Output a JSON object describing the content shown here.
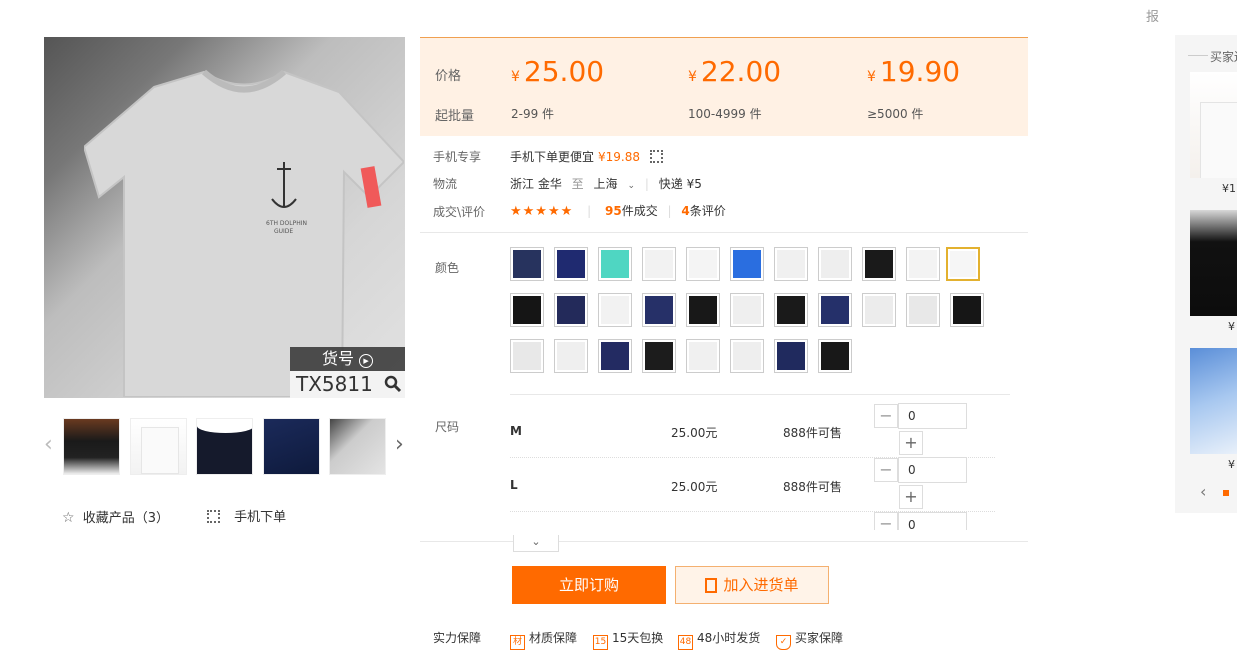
{
  "header": {
    "cut_title": "",
    "report_label": "报"
  },
  "gallery": {
    "sku_label": "货号",
    "sku_number": "TX5811",
    "favorite_label": "收藏产品（3）",
    "mobile_order_label": "手机下单"
  },
  "price_box": {
    "price_label": "价格",
    "min_order_label": "起批量",
    "currency": "¥",
    "tiers": [
      {
        "price": "25.00",
        "range": "2-99 件"
      },
      {
        "price": "22.00",
        "range": "100-4999 件"
      },
      {
        "price": "19.90",
        "range": "≥5000 件"
      }
    ]
  },
  "mobile_exclusive": {
    "label": "手机专享",
    "text": "手机下单更便宜",
    "price": "¥19.88"
  },
  "logistics": {
    "label": "物流",
    "from": "浙江 金华",
    "to_word": "至",
    "to": "上海",
    "shipping": "快递 ¥5"
  },
  "deals": {
    "label": "成交\\评价",
    "stars": "★★★★★",
    "count": "95",
    "count_suffix": "件成交",
    "reviews": "4",
    "reviews_suffix": "条评价"
  },
  "color": {
    "label": "颜色"
  },
  "size": {
    "label": "尺码",
    "rows": [
      {
        "name": "M",
        "price": "25.00元",
        "stock": "888件可售",
        "qty": "0"
      },
      {
        "name": "L",
        "price": "25.00元",
        "stock": "888件可售",
        "qty": "0"
      },
      {
        "name": "",
        "price": "",
        "stock": "",
        "qty": "0"
      }
    ]
  },
  "actions": {
    "buy_now": "立即订购",
    "add_cart": "加入进货单"
  },
  "guarantee": {
    "label": "实力保障",
    "items": [
      "材质保障",
      "15天包换",
      "48小时发货",
      "买家保障"
    ]
  },
  "sidebar": {
    "title": "买家还",
    "prices": [
      "¥1",
      "¥",
      "¥"
    ]
  },
  "colors": {
    "accent": "#ff6a00",
    "price_bg": "#fff1e4",
    "selected_border": "#e3b12f"
  }
}
